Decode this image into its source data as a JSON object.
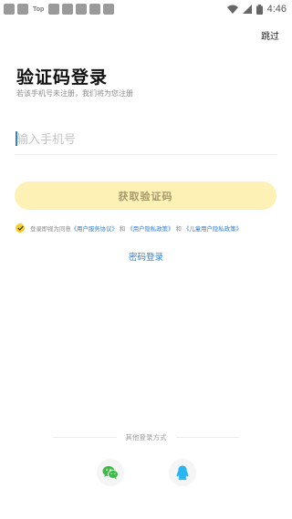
{
  "status_bar": {
    "app_label": "Top",
    "time": "4:46"
  },
  "header": {
    "skip_label": "跳过"
  },
  "main": {
    "title": "验证码登录",
    "subtitle": "若该手机号未注册，我们将为您注册",
    "phone_placeholder": "输入手机号",
    "phone_value": "",
    "get_code_label": "获取验证码"
  },
  "agreement": {
    "prefix": "登录即视为同意",
    "link1": "《用户服务协议》",
    "and1": "和",
    "link2": "《用户隐私政策》",
    "and2": "和",
    "link3": "《儿童用户隐私政策》",
    "checked": true
  },
  "password_login_label": "密码登录",
  "other_login": {
    "label": "其他登录方式",
    "options": [
      "wechat",
      "qq"
    ]
  },
  "colors": {
    "accent_yellow": "#f7cf27",
    "button_bg": "#fdf1b5",
    "link_blue": "#2f7dd1",
    "wechat_green": "#3dbb46",
    "qq_blue": "#2bb6f1"
  }
}
